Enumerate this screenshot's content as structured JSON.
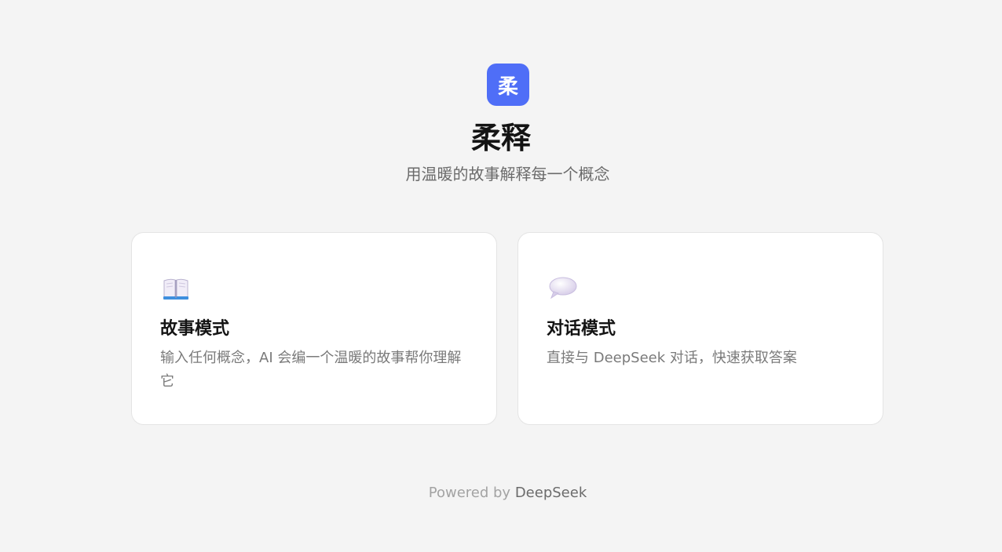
{
  "app": {
    "logo_text": "柔",
    "title": "柔释",
    "subtitle": "用温暖的故事解释每一个概念",
    "accent_color": "#4f6ef7"
  },
  "modes": [
    {
      "icon": "open-book-icon",
      "title": "故事模式",
      "description": "输入任何概念，AI 会编一个温暖的故事帮你理解它"
    },
    {
      "icon": "speech-bubble-icon",
      "title": "对话模式",
      "description": "直接与 DeepSeek 对话，快速获取答案"
    }
  ],
  "footer": {
    "powered_by": "Powered by",
    "brand": "DeepSeek"
  }
}
